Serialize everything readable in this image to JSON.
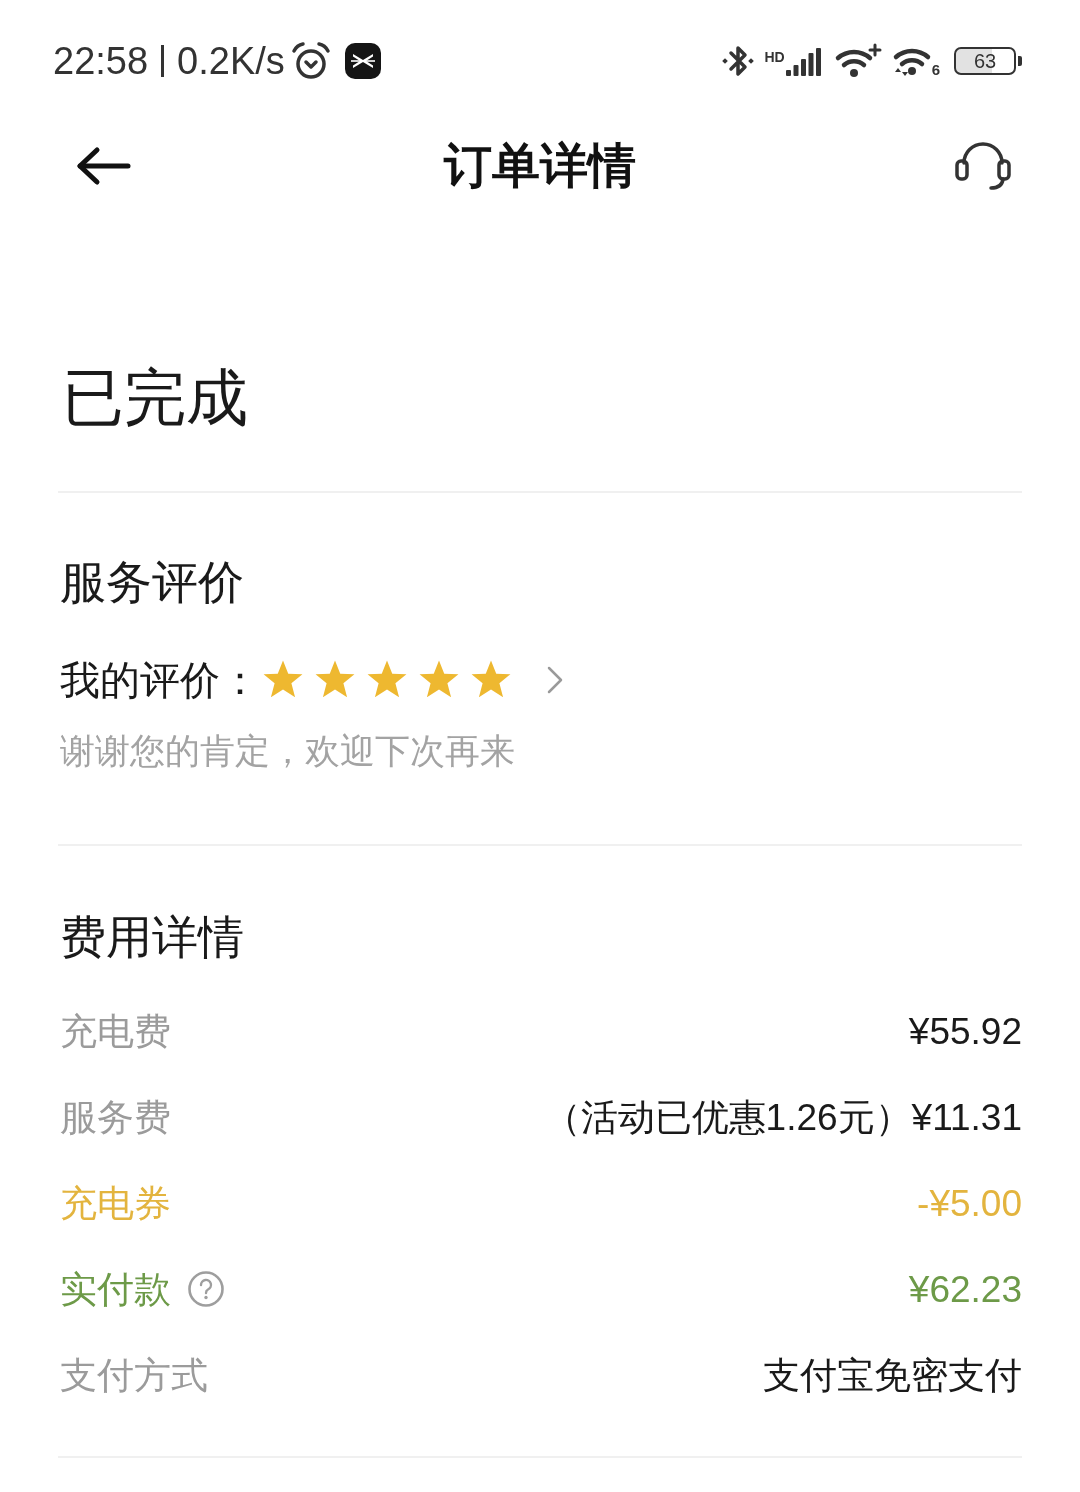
{
  "status_bar": {
    "time": "22:58",
    "network_speed": "0.2K/s",
    "network_badge": "HD",
    "wifi_badge": "6",
    "battery": "63"
  },
  "header": {
    "title": "订单详情"
  },
  "order_status": "已完成",
  "review": {
    "title": "服务评价",
    "label": "我的评价：",
    "stars": 5,
    "message": "谢谢您的肯定，欢迎下次再来"
  },
  "fees": {
    "title": "费用详情",
    "rows": [
      {
        "label": "充电费",
        "value": "¥55.92",
        "kind": "normal"
      },
      {
        "label": "服务费",
        "note": "（活动已优惠1.26元）",
        "value": "¥11.31",
        "kind": "normal"
      },
      {
        "label": "充电券",
        "value": "-¥5.00",
        "kind": "discount"
      },
      {
        "label": "实付款",
        "value": "¥62.23",
        "kind": "total"
      },
      {
        "label": "支付方式",
        "value": "支付宝免密支付",
        "kind": "normal"
      }
    ]
  }
}
